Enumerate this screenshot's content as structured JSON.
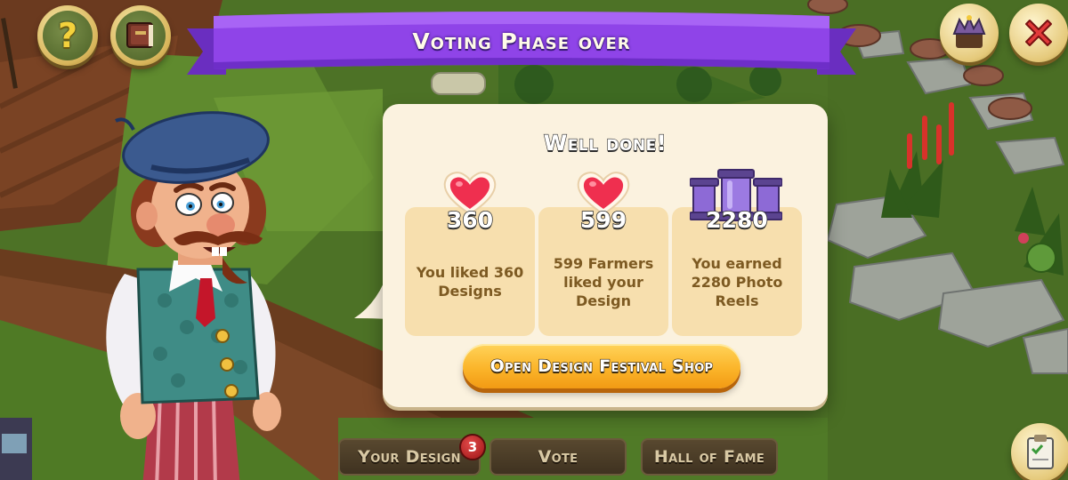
{
  "ribbon": {
    "title": "Voting Phase over"
  },
  "dialog": {
    "heading": "Well done!",
    "stats": [
      {
        "icon": "heart-icon",
        "value": "360",
        "description_lines": [
          "You liked 360",
          "Designs"
        ]
      },
      {
        "icon": "heart-icon",
        "value": "599",
        "description_lines": [
          "599 Farmers",
          "liked your",
          "Design"
        ]
      },
      {
        "icon": "photo-reels-icon",
        "value": "2280",
        "description_lines": [
          "You earned",
          "2280 Photo",
          "Reels"
        ]
      }
    ],
    "shop_button_label": "Open Design Festival Shop"
  },
  "tabs": {
    "your_design": "Your Design",
    "your_design_badge": "3",
    "vote": "Vote",
    "hall_of_fame": "Hall of Fame"
  },
  "top_left_buttons": {
    "help_label": "?",
    "help_icon": "question-icon",
    "book_icon": "book-icon"
  },
  "top_right_buttons": {
    "crown_icon": "crown-icon",
    "close_icon": "close-icon"
  },
  "bottom_right_button": {
    "icon": "clipboard-icon"
  },
  "colors": {
    "ribbon": "#8f44e8",
    "dialog_bg": "#fbf2df",
    "card_bg": "#f7dfae",
    "button_orange": "#fbb52a",
    "heart_red": "#ef2f4f",
    "reel_purple": "#8d6ad6"
  }
}
